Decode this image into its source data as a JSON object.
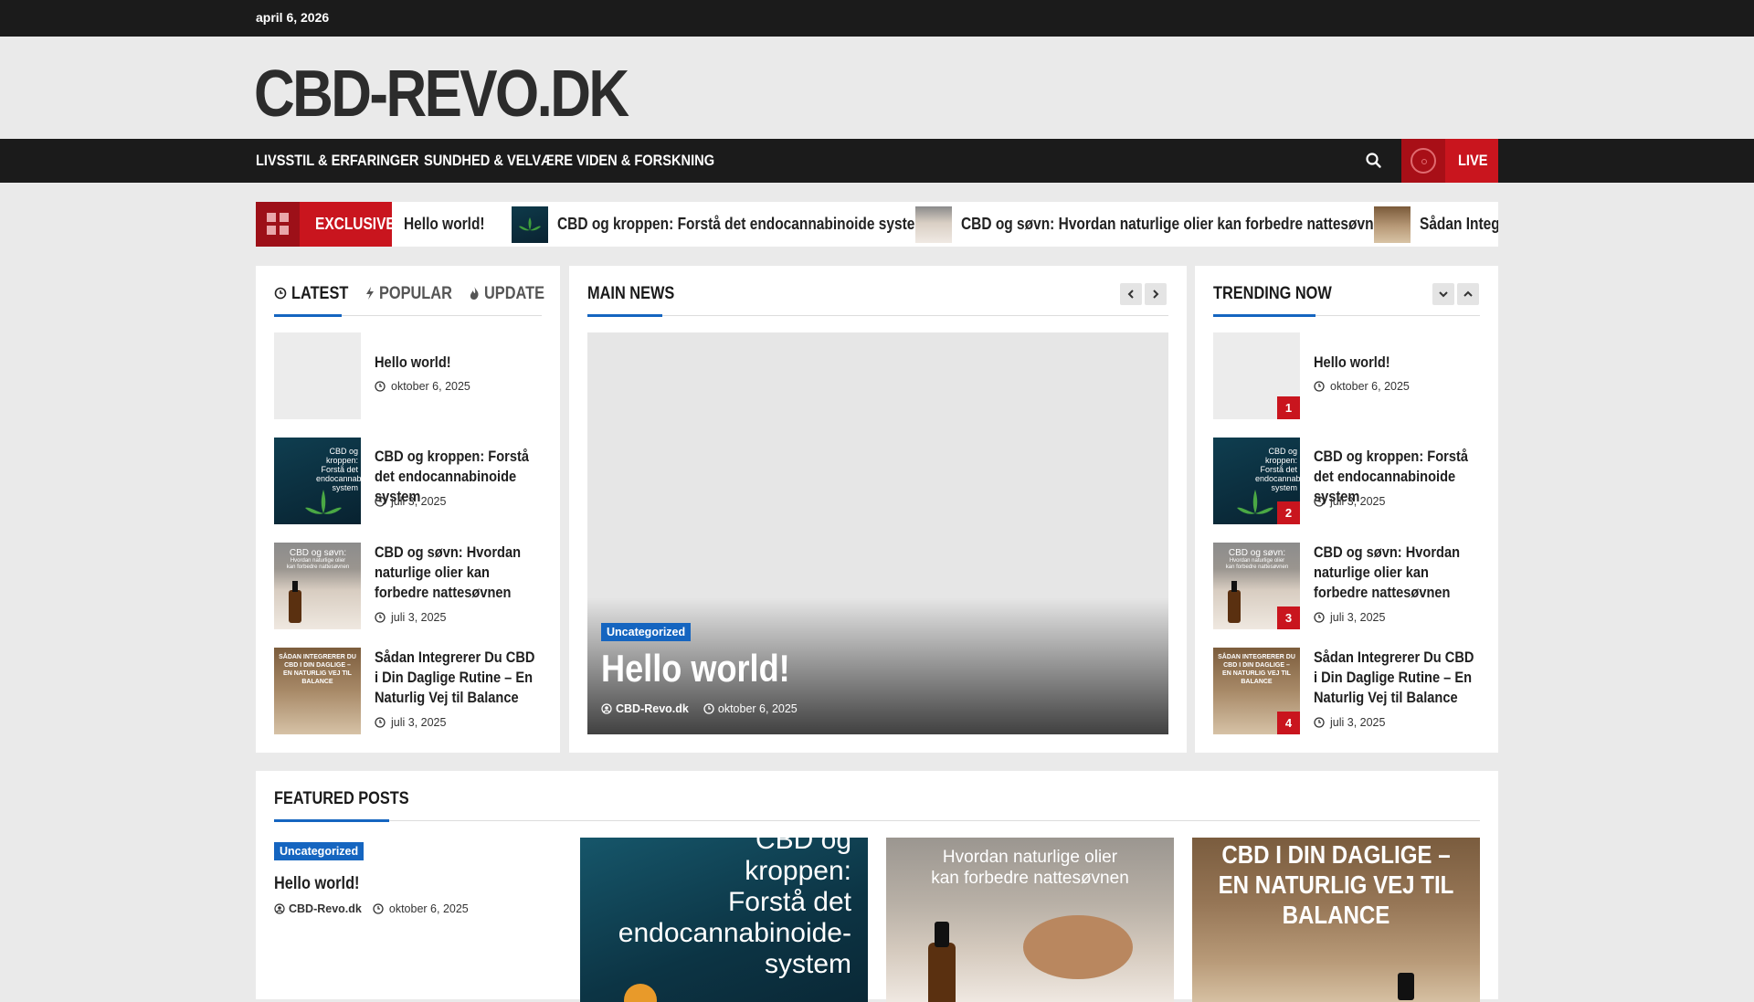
{
  "topbar": {
    "date": "april 6, 2026"
  },
  "header": {
    "site_title": "CBD-REVO.DK"
  },
  "nav": {
    "items": [
      "LIVSSTIL & ERFARINGER",
      "SUNDHED & VELVÆRE",
      "VIDEN & FORSKNING"
    ],
    "live_label": "LIVE"
  },
  "ticker": {
    "label": "EXCLUSIVE",
    "items": [
      "Hello world!",
      "CBD og kroppen: Forstå det endocannabinoide system",
      "CBD og søvn: Hvordan naturlige olier kan forbedre nattesøvnen",
      "Sådan Integ"
    ]
  },
  "left_panel": {
    "tabs": [
      "LATEST",
      "POPULAR",
      "UPDATE"
    ],
    "posts": [
      {
        "title": "Hello world!",
        "date": "oktober 6, 2025"
      },
      {
        "title": "CBD og kroppen: Forstå det endocannabinoide system",
        "date": "juli 3, 2025"
      },
      {
        "title": "CBD og søvn: Hvordan naturlige olier kan forbedre nattesøvnen",
        "date": "juli 3, 2025"
      },
      {
        "title": "Sådan Integrerer Du CBD i Din Daglige Rutine – En Naturlig Vej til Balance",
        "date": "juli 3, 2025"
      }
    ]
  },
  "main_news": {
    "heading": "MAIN NEWS",
    "category": "Uncategorized",
    "title": "Hello world!",
    "author": "CBD-Revo.dk",
    "date": "oktober 6, 2025"
  },
  "trending": {
    "heading": "TRENDING NOW",
    "posts": [
      {
        "rank": "1",
        "title": "Hello world!",
        "date": "oktober 6, 2025"
      },
      {
        "rank": "2",
        "title": "CBD og kroppen: Forstå det endocannabinoide system",
        "date": "juli 3, 2025"
      },
      {
        "rank": "3",
        "title": "CBD og søvn: Hvordan naturlige olier kan forbedre nattesøvnen",
        "date": "juli 3, 2025"
      },
      {
        "rank": "4",
        "title": "Sådan Integrerer Du CBD i Din Daglige Rutine – En Naturlig Vej til Balance",
        "date": "juli 3, 2025"
      }
    ]
  },
  "thumbs": {
    "body": {
      "line1": "CBD og",
      "line2": "kroppen:",
      "line3": "Forstå det",
      "line4": "endocannabinoide-",
      "line5": "system"
    },
    "sleep": {
      "line1": "CBD og søvn:",
      "line2": "Hvordan naturlige olier",
      "line3": "kan forbedre nattesøvnen"
    },
    "daily": {
      "line1": "SÅDAN INTEGRERER DU",
      "line2": "CBD I DIN DAGLIGE –",
      "line3": "EN NATURLIG VEJ TIL",
      "line4": "BALANCE"
    }
  },
  "featured": {
    "heading": "FEATURED POSTS",
    "first": {
      "category": "Uncategorized",
      "title": "Hello world!",
      "author": "CBD-Revo.dk",
      "date": "oktober 6, 2025"
    },
    "img1": {
      "line1": "CBD og",
      "line2": "kroppen:",
      "line3": "Forstå det",
      "line4": "endocannabinoide-",
      "line5": "system"
    },
    "img2": {
      "line1": "Hvordan naturlige olier",
      "line2": "kan forbedre nattesøvnen"
    },
    "img3": {
      "line1": "CBD I DIN DAGLIGE –",
      "line2": "EN NATURLIG VEJ TIL",
      "line3": "BALANCE"
    }
  },
  "colors": {
    "accent_red": "#c9151e",
    "accent_blue": "#1565c0",
    "dark": "#1b1b1b"
  }
}
